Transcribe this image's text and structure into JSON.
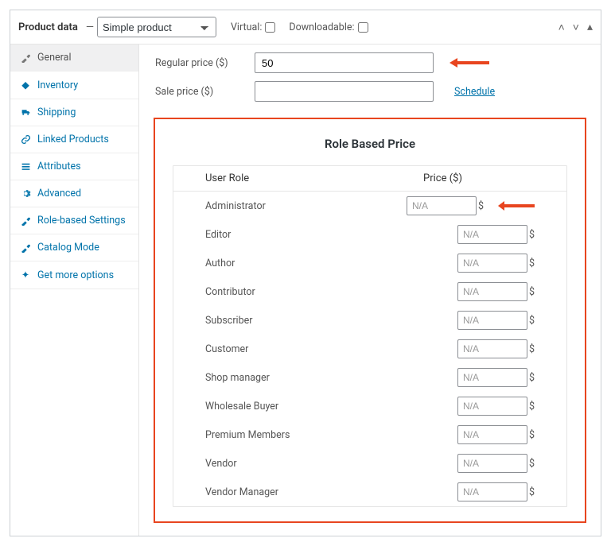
{
  "header": {
    "title": "Product data",
    "separator": "—",
    "product_type": "Simple product",
    "virtual_label": "Virtual:",
    "downloadable_label": "Downloadable:"
  },
  "tabs": [
    {
      "id": "general",
      "label": "General"
    },
    {
      "id": "inventory",
      "label": "Inventory"
    },
    {
      "id": "shipping",
      "label": "Shipping"
    },
    {
      "id": "linked",
      "label": "Linked Products"
    },
    {
      "id": "attributes",
      "label": "Attributes"
    },
    {
      "id": "advanced",
      "label": "Advanced"
    },
    {
      "id": "rbs",
      "label": "Role-based Settings"
    },
    {
      "id": "catalog",
      "label": "Catalog Mode"
    },
    {
      "id": "more",
      "label": "Get more options"
    }
  ],
  "pricing": {
    "regular_label": "Regular price ($)",
    "regular_value": "50",
    "sale_label": "Sale price ($)",
    "sale_value": "",
    "schedule_label": "Schedule"
  },
  "rbp": {
    "title": "Role Based Price",
    "col_role": "User Role",
    "col_price": "Price ($)",
    "placeholder": "N/A",
    "currency": "$",
    "roles": [
      "Administrator",
      "Editor",
      "Author",
      "Contributor",
      "Subscriber",
      "Customer",
      "Shop manager",
      "Wholesale Buyer",
      "Premium Members",
      "Vendor",
      "Vendor Manager"
    ]
  }
}
